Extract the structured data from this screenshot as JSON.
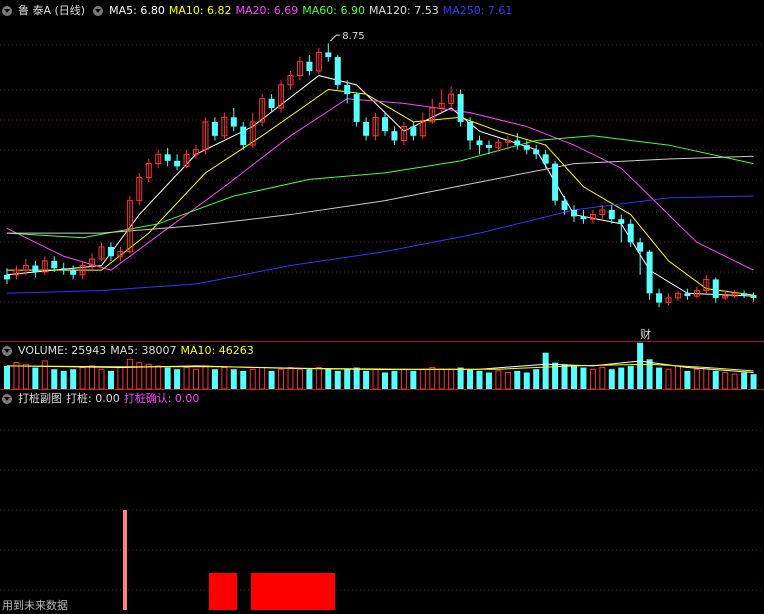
{
  "main_panel": {
    "stock_name": "鲁 泰A (日线)",
    "indicators": [
      {
        "label": "MA5: 6.80",
        "color": "#ffffff"
      },
      {
        "label": "MA10: 6.82",
        "color": "#ffff00"
      },
      {
        "label": "MA20: 6.69",
        "color": "#ff44ff"
      },
      {
        "label": "MA60: 6.90",
        "color": "#44ff44"
      },
      {
        "label": "MA120: 7.53",
        "color": "#dddddd"
      },
      {
        "label": "MA250: 7.61",
        "color": "#3333ff"
      }
    ],
    "high_marker": "8.75",
    "event_marker": "财"
  },
  "volume_panel": {
    "indicators": [
      {
        "label": "VOLUME: 25943",
        "color": "#dddddd"
      },
      {
        "label": "MA5: 38007",
        "color": "#dddddd"
      },
      {
        "label": "MA10: 46263",
        "color": "#ffff00"
      }
    ]
  },
  "sub_panel": {
    "indicators": [
      {
        "label": "打桩副图",
        "color": "#dddddd"
      },
      {
        "label": "打桩: 0.00",
        "color": "#dddddd"
      },
      {
        "label": "打桩确认: 0.00",
        "color": "#ff44ff"
      }
    ]
  },
  "footer": "用到未来数据",
  "colors": {
    "up": "#ff3333",
    "down": "#55ffff",
    "grid": "#801010",
    "bar": "#ff0000",
    "spike": "#ff8080"
  },
  "chart_data": {
    "type": "candlestick",
    "y_range": [
      5.6,
      9.0
    ],
    "candles": [
      [
        6.2,
        6.25,
        6.32,
        6.15,
        "d"
      ],
      [
        6.25,
        6.3,
        6.35,
        6.2,
        "u"
      ],
      [
        6.3,
        6.35,
        6.42,
        6.25,
        "u"
      ],
      [
        6.35,
        6.28,
        6.4,
        6.22,
        "d"
      ],
      [
        6.28,
        6.4,
        6.45,
        6.25,
        "u"
      ],
      [
        6.4,
        6.32,
        6.45,
        6.28,
        "d"
      ],
      [
        6.32,
        6.3,
        6.38,
        6.25,
        "d"
      ],
      [
        6.3,
        6.25,
        6.35,
        6.2,
        "d"
      ],
      [
        6.25,
        6.35,
        6.4,
        6.2,
        "u"
      ],
      [
        6.35,
        6.42,
        6.48,
        6.3,
        "u"
      ],
      [
        6.42,
        6.55,
        6.6,
        6.4,
        "u"
      ],
      [
        6.55,
        6.45,
        6.6,
        6.4,
        "d"
      ],
      [
        6.45,
        6.5,
        6.55,
        6.4,
        "u"
      ],
      [
        6.5,
        7.05,
        7.1,
        6.48,
        "u"
      ],
      [
        7.05,
        7.3,
        7.35,
        7.0,
        "u"
      ],
      [
        7.3,
        7.45,
        7.5,
        7.25,
        "u"
      ],
      [
        7.45,
        7.55,
        7.6,
        7.4,
        "u"
      ],
      [
        7.55,
        7.48,
        7.62,
        7.42,
        "d"
      ],
      [
        7.48,
        7.42,
        7.55,
        7.38,
        "d"
      ],
      [
        7.42,
        7.55,
        7.6,
        7.4,
        "u"
      ],
      [
        7.55,
        7.6,
        7.65,
        7.5,
        "u"
      ],
      [
        7.6,
        7.9,
        7.95,
        7.55,
        "u"
      ],
      [
        7.9,
        7.75,
        7.95,
        7.7,
        "d"
      ],
      [
        7.75,
        7.95,
        8.0,
        7.72,
        "u"
      ],
      [
        7.95,
        7.85,
        8.05,
        7.8,
        "d"
      ],
      [
        7.85,
        7.65,
        7.9,
        7.6,
        "d"
      ],
      [
        7.65,
        7.9,
        8.0,
        7.62,
        "u"
      ],
      [
        7.9,
        8.15,
        8.2,
        7.85,
        "u"
      ],
      [
        8.15,
        8.05,
        8.2,
        8.0,
        "d"
      ],
      [
        8.05,
        8.3,
        8.35,
        8.0,
        "u"
      ],
      [
        8.3,
        8.4,
        8.45,
        8.25,
        "u"
      ],
      [
        8.4,
        8.55,
        8.6,
        8.35,
        "u"
      ],
      [
        8.55,
        8.45,
        8.62,
        8.4,
        "d"
      ],
      [
        8.45,
        8.65,
        8.7,
        8.42,
        "u"
      ],
      [
        8.65,
        8.6,
        8.75,
        8.55,
        "d"
      ],
      [
        8.6,
        8.3,
        8.62,
        8.25,
        "d"
      ],
      [
        8.3,
        8.2,
        8.35,
        8.1,
        "d"
      ],
      [
        8.2,
        7.9,
        8.22,
        7.85,
        "d"
      ],
      [
        7.9,
        7.75,
        7.95,
        7.7,
        "d"
      ],
      [
        7.75,
        7.95,
        8.0,
        7.7,
        "u"
      ],
      [
        7.95,
        7.8,
        8.0,
        7.75,
        "d"
      ],
      [
        7.8,
        7.7,
        7.85,
        7.65,
        "d"
      ],
      [
        7.7,
        7.85,
        7.9,
        7.65,
        "u"
      ],
      [
        7.85,
        7.75,
        7.9,
        7.7,
        "d"
      ],
      [
        7.75,
        7.9,
        8.0,
        7.72,
        "u"
      ],
      [
        7.9,
        8.05,
        8.15,
        7.88,
        "u"
      ],
      [
        8.05,
        8.1,
        8.25,
        8.0,
        "u"
      ],
      [
        8.1,
        8.2,
        8.28,
        8.05,
        "u"
      ],
      [
        8.2,
        7.9,
        8.25,
        7.85,
        "d"
      ],
      [
        7.9,
        7.7,
        7.95,
        7.6,
        "d"
      ],
      [
        7.7,
        7.65,
        7.75,
        7.55,
        "d"
      ],
      [
        7.65,
        7.62,
        7.7,
        7.55,
        "d"
      ],
      [
        7.62,
        7.68,
        7.72,
        7.58,
        "u"
      ],
      [
        7.68,
        7.7,
        7.75,
        7.6,
        "u"
      ],
      [
        7.7,
        7.65,
        7.78,
        7.6,
        "d"
      ],
      [
        7.65,
        7.6,
        7.7,
        7.55,
        "d"
      ],
      [
        7.6,
        7.55,
        7.65,
        7.5,
        "d"
      ],
      [
        7.55,
        7.45,
        7.6,
        7.4,
        "d"
      ],
      [
        7.45,
        7.05,
        7.48,
        7.0,
        "d"
      ],
      [
        7.05,
        6.95,
        7.1,
        6.9,
        "d"
      ],
      [
        6.95,
        6.88,
        7.0,
        6.82,
        "d"
      ],
      [
        6.88,
        6.85,
        6.95,
        6.8,
        "d"
      ],
      [
        6.85,
        6.9,
        6.95,
        6.8,
        "u"
      ],
      [
        6.9,
        6.95,
        7.0,
        6.85,
        "u"
      ],
      [
        6.95,
        6.85,
        7.0,
        6.8,
        "d"
      ],
      [
        6.85,
        6.8,
        6.9,
        6.6,
        "d"
      ],
      [
        6.8,
        6.6,
        6.85,
        6.55,
        "d"
      ],
      [
        6.6,
        6.5,
        6.65,
        6.25,
        "d"
      ],
      [
        6.5,
        6.05,
        6.52,
        5.98,
        "d"
      ],
      [
        6.05,
        5.95,
        6.1,
        5.9,
        "d"
      ],
      [
        5.95,
        6.0,
        6.05,
        5.92,
        "u"
      ],
      [
        6.0,
        6.05,
        6.08,
        5.97,
        "u"
      ],
      [
        6.05,
        6.02,
        6.1,
        5.98,
        "d"
      ],
      [
        6.02,
        6.08,
        6.12,
        6.0,
        "u"
      ],
      [
        6.08,
        6.2,
        6.25,
        6.05,
        "u"
      ],
      [
        6.2,
        6.0,
        6.22,
        5.95,
        "d"
      ],
      [
        6.0,
        6.02,
        6.08,
        5.98,
        "u"
      ],
      [
        6.02,
        6.05,
        6.08,
        6.0,
        "u"
      ],
      [
        6.05,
        6.03,
        6.08,
        6.0,
        "d"
      ],
      [
        6.03,
        6.0,
        6.06,
        5.96,
        "d"
      ]
    ],
    "ma_lines": [
      {
        "name": "MA5",
        "color": "#ffffff",
        "values": [
          [
            0,
            6.25
          ],
          [
            10,
            6.35
          ],
          [
            14,
            6.9
          ],
          [
            20,
            7.55
          ],
          [
            26,
            7.85
          ],
          [
            33,
            8.4
          ],
          [
            37,
            8.3
          ],
          [
            42,
            7.8
          ],
          [
            47,
            8.05
          ],
          [
            50,
            7.8
          ],
          [
            56,
            7.6
          ],
          [
            60,
            6.9
          ],
          [
            65,
            6.8
          ],
          [
            68,
            6.3
          ],
          [
            72,
            6.05
          ],
          [
            79,
            6.02
          ]
        ]
      },
      {
        "name": "MA10",
        "color": "#ffff00",
        "values": [
          [
            0,
            6.3
          ],
          [
            10,
            6.3
          ],
          [
            15,
            6.7
          ],
          [
            21,
            7.35
          ],
          [
            27,
            7.75
          ],
          [
            34,
            8.25
          ],
          [
            38,
            8.2
          ],
          [
            43,
            7.9
          ],
          [
            48,
            7.95
          ],
          [
            52,
            7.8
          ],
          [
            57,
            7.65
          ],
          [
            61,
            7.2
          ],
          [
            66,
            6.9
          ],
          [
            70,
            6.4
          ],
          [
            74,
            6.1
          ],
          [
            79,
            6.03
          ]
        ]
      },
      {
        "name": "MA20",
        "color": "#ff44ff",
        "values": [
          [
            0,
            6.75
          ],
          [
            6,
            6.45
          ],
          [
            11,
            6.3
          ],
          [
            17,
            6.75
          ],
          [
            23,
            7.2
          ],
          [
            30,
            7.75
          ],
          [
            36,
            8.15
          ],
          [
            42,
            8.1
          ],
          [
            49,
            8.0
          ],
          [
            55,
            7.85
          ],
          [
            60,
            7.65
          ],
          [
            65,
            7.4
          ],
          [
            69,
            7.0
          ],
          [
            73,
            6.6
          ],
          [
            79,
            6.3
          ]
        ]
      },
      {
        "name": "MA60",
        "color": "#44ff44",
        "values": [
          [
            0,
            6.7
          ],
          [
            8,
            6.65
          ],
          [
            16,
            6.8
          ],
          [
            24,
            7.1
          ],
          [
            32,
            7.28
          ],
          [
            40,
            7.35
          ],
          [
            48,
            7.48
          ],
          [
            56,
            7.7
          ],
          [
            62,
            7.75
          ],
          [
            70,
            7.65
          ],
          [
            79,
            7.45
          ]
        ]
      },
      {
        "name": "MA120",
        "color": "#cccccc",
        "values": [
          [
            0,
            6.7
          ],
          [
            10,
            6.7
          ],
          [
            20,
            6.78
          ],
          [
            30,
            6.9
          ],
          [
            40,
            7.05
          ],
          [
            50,
            7.25
          ],
          [
            60,
            7.45
          ],
          [
            70,
            7.5
          ],
          [
            79,
            7.53
          ]
        ]
      },
      {
        "name": "MA250",
        "color": "#3333ff",
        "values": [
          [
            0,
            6.05
          ],
          [
            10,
            6.08
          ],
          [
            20,
            6.15
          ],
          [
            30,
            6.35
          ],
          [
            40,
            6.5
          ],
          [
            50,
            6.7
          ],
          [
            60,
            6.95
          ],
          [
            70,
            7.08
          ],
          [
            79,
            7.1
          ]
        ]
      }
    ],
    "volume": [
      [
        14,
        "d"
      ],
      [
        16,
        "u"
      ],
      [
        15,
        "u"
      ],
      [
        13,
        "d"
      ],
      [
        17,
        "u"
      ],
      [
        12,
        "d"
      ],
      [
        11,
        "d"
      ],
      [
        12,
        "d"
      ],
      [
        13,
        "u"
      ],
      [
        14,
        "u"
      ],
      [
        12,
        "u"
      ],
      [
        11,
        "d"
      ],
      [
        13,
        "u"
      ],
      [
        18,
        "u"
      ],
      [
        16,
        "u"
      ],
      [
        15,
        "u"
      ],
      [
        14,
        "u"
      ],
      [
        13,
        "d"
      ],
      [
        12,
        "d"
      ],
      [
        13,
        "u"
      ],
      [
        12,
        "u"
      ],
      [
        14,
        "u"
      ],
      [
        12,
        "d"
      ],
      [
        13,
        "u"
      ],
      [
        12,
        "d"
      ],
      [
        11,
        "d"
      ],
      [
        12,
        "u"
      ],
      [
        13,
        "u"
      ],
      [
        11,
        "d"
      ],
      [
        12,
        "u"
      ],
      [
        13,
        "u"
      ],
      [
        12,
        "u"
      ],
      [
        12,
        "d"
      ],
      [
        13,
        "u"
      ],
      [
        12,
        "d"
      ],
      [
        11,
        "d"
      ],
      [
        12,
        "d"
      ],
      [
        13,
        "d"
      ],
      [
        11,
        "d"
      ],
      [
        12,
        "u"
      ],
      [
        10,
        "d"
      ],
      [
        11,
        "d"
      ],
      [
        12,
        "u"
      ],
      [
        11,
        "d"
      ],
      [
        12,
        "u"
      ],
      [
        13,
        "u"
      ],
      [
        12,
        "u"
      ],
      [
        12,
        "u"
      ],
      [
        13,
        "d"
      ],
      [
        12,
        "d"
      ],
      [
        11,
        "d"
      ],
      [
        10,
        "d"
      ],
      [
        11,
        "u"
      ],
      [
        10,
        "u"
      ],
      [
        11,
        "d"
      ],
      [
        10,
        "d"
      ],
      [
        12,
        "d"
      ],
      [
        22,
        "d"
      ],
      [
        16,
        "d"
      ],
      [
        15,
        "d"
      ],
      [
        14,
        "d"
      ],
      [
        13,
        "d"
      ],
      [
        12,
        "u"
      ],
      [
        13,
        "u"
      ],
      [
        12,
        "d"
      ],
      [
        13,
        "d"
      ],
      [
        14,
        "d"
      ],
      [
        28,
        "d"
      ],
      [
        18,
        "d"
      ],
      [
        13,
        "d"
      ],
      [
        12,
        "u"
      ],
      [
        14,
        "u"
      ],
      [
        11,
        "d"
      ],
      [
        12,
        "u"
      ],
      [
        13,
        "u"
      ],
      [
        11,
        "d"
      ],
      [
        10,
        "u"
      ],
      [
        9,
        "u"
      ],
      [
        10,
        "d"
      ],
      [
        9,
        "d"
      ]
    ],
    "sub_bars": [
      {
        "x_from": 209,
        "x_to": 237,
        "color": "#ff0000"
      },
      {
        "x_from": 251,
        "x_to": 335,
        "color": "#ff0000"
      }
    ],
    "sub_spike_x": 125
  }
}
